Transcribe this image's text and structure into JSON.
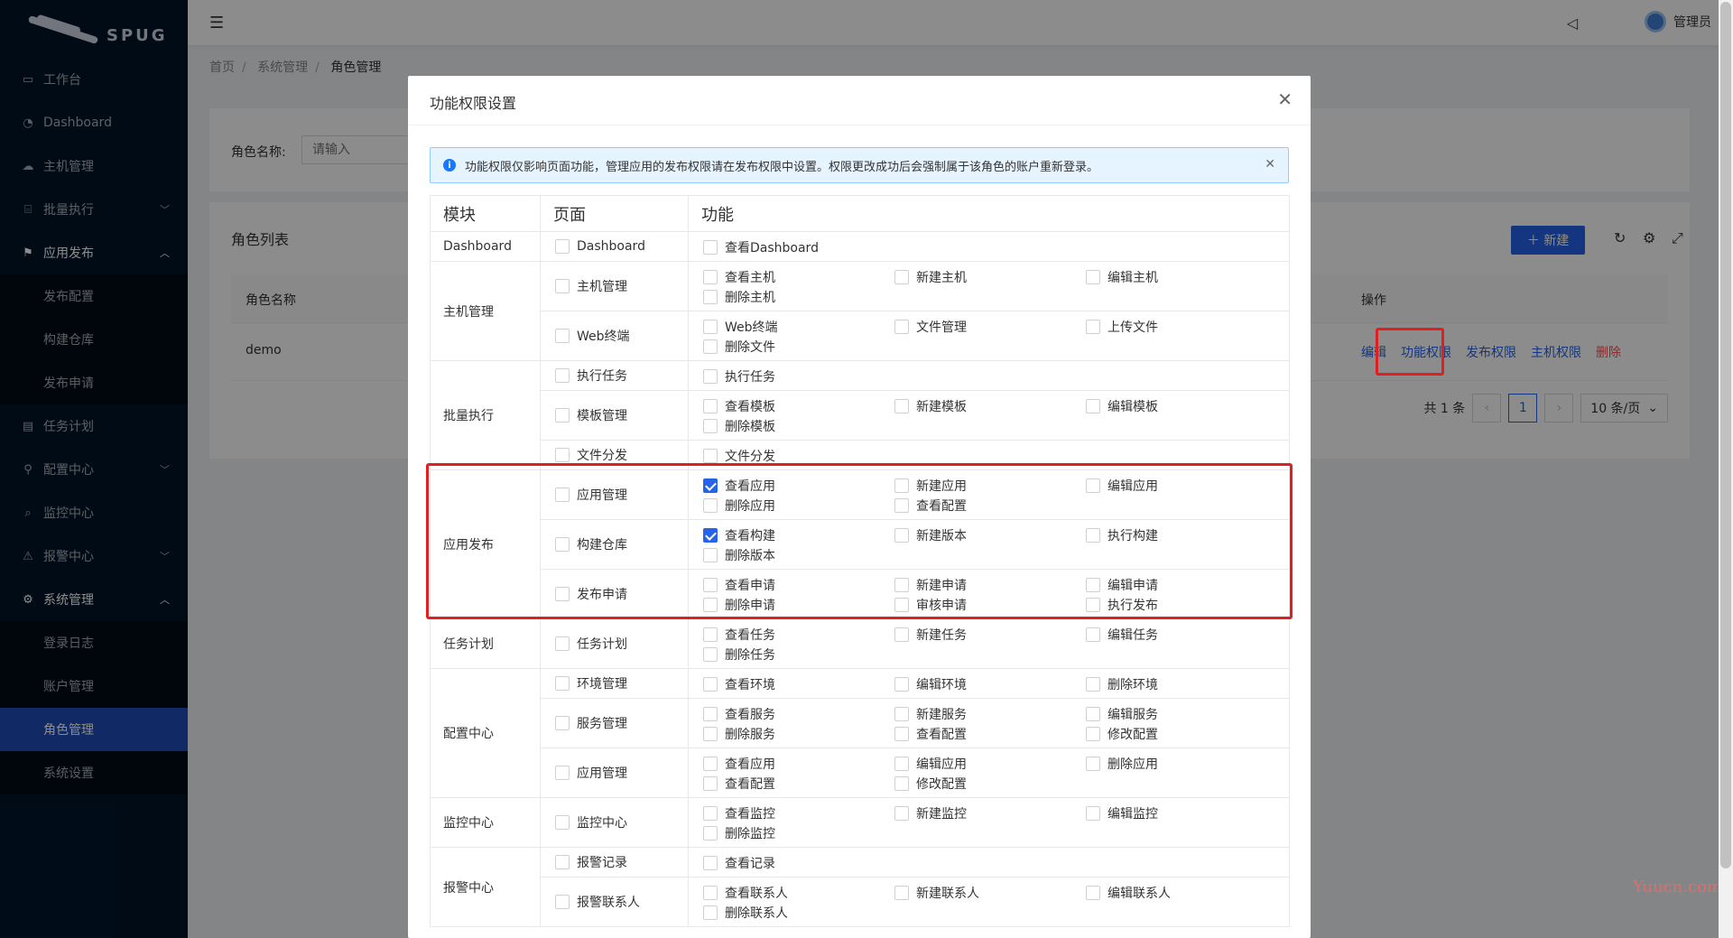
{
  "logo": {
    "text": "SPUG"
  },
  "sidebar": {
    "items": [
      {
        "label": "工作台",
        "icon": "desktop-icon"
      },
      {
        "label": "Dashboard",
        "icon": "dashboard-icon"
      },
      {
        "label": "主机管理",
        "icon": "cloud-server-icon"
      },
      {
        "label": "批量执行",
        "icon": "code-icon",
        "arrow": "down"
      },
      {
        "label": "应用发布",
        "icon": "flag-icon",
        "arrow": "up",
        "children": [
          "发布配置",
          "构建仓库",
          "发布申请"
        ]
      },
      {
        "label": "任务计划",
        "icon": "schedule-icon"
      },
      {
        "label": "配置中心",
        "icon": "deployment-icon",
        "arrow": "down"
      },
      {
        "label": "监控中心",
        "icon": "monitor-icon"
      },
      {
        "label": "报警中心",
        "icon": "alert-icon",
        "arrow": "down"
      },
      {
        "label": "系统管理",
        "icon": "setting-icon",
        "arrow": "up",
        "children": [
          "登录日志",
          "账户管理",
          "角色管理",
          "系统设置"
        ]
      }
    ],
    "active": "角色管理"
  },
  "header": {
    "user": "管理员"
  },
  "breadcrumb": [
    "首页",
    "系统管理",
    "角色管理"
  ],
  "search": {
    "label": "角色名称:",
    "placeholder": "请输入"
  },
  "list": {
    "title": "角色列表",
    "add_label": "新建",
    "columns": {
      "name": "角色名称",
      "ops": "操作"
    },
    "rows": [
      {
        "name": "demo"
      }
    ],
    "ops": [
      "编辑",
      "功能权限",
      "发布权限",
      "主机权限",
      "删除"
    ],
    "pager": {
      "total": "共 1 条",
      "current": "1",
      "size": "10 条/页"
    }
  },
  "modal": {
    "title": "功能权限设置",
    "alert": "功能权限仅影响页面功能，管理应用的发布权限请在发布权限中设置。权限更改成功后会强制属于该角色的账户重新登录。",
    "headers": [
      "模块",
      "页面",
      "功能"
    ],
    "modules": [
      {
        "name": "Dashboard",
        "pages": [
          {
            "name": "Dashboard",
            "funcs": [
              {
                "l": "查看Dashboard"
              }
            ]
          }
        ]
      },
      {
        "name": "主机管理",
        "pages": [
          {
            "name": "主机管理",
            "funcs": [
              {
                "l": "查看主机"
              },
              {
                "l": "新建主机"
              },
              {
                "l": "编辑主机"
              },
              {
                "l": "删除主机"
              }
            ]
          },
          {
            "name": "Web终端",
            "funcs": [
              {
                "l": "Web终端"
              },
              {
                "l": "文件管理"
              },
              {
                "l": "上传文件"
              },
              {
                "l": "删除文件"
              }
            ]
          }
        ]
      },
      {
        "name": "批量执行",
        "pages": [
          {
            "name": "执行任务",
            "funcs": [
              {
                "l": "执行任务"
              }
            ]
          },
          {
            "name": "模板管理",
            "funcs": [
              {
                "l": "查看模板"
              },
              {
                "l": "新建模板"
              },
              {
                "l": "编辑模板"
              },
              {
                "l": "删除模板"
              }
            ]
          },
          {
            "name": "文件分发",
            "funcs": [
              {
                "l": "文件分发"
              }
            ]
          }
        ]
      },
      {
        "name": "应用发布",
        "pages": [
          {
            "name": "应用管理",
            "funcs": [
              {
                "l": "查看应用",
                "c": true
              },
              {
                "l": "新建应用"
              },
              {
                "l": "编辑应用"
              },
              {
                "l": "删除应用"
              },
              {
                "l": "查看配置"
              }
            ]
          },
          {
            "name": "构建仓库",
            "funcs": [
              {
                "l": "查看构建",
                "c": true
              },
              {
                "l": "新建版本"
              },
              {
                "l": "执行构建"
              },
              {
                "l": "删除版本"
              }
            ]
          },
          {
            "name": "发布申请",
            "funcs": [
              {
                "l": "查看申请"
              },
              {
                "l": "新建申请"
              },
              {
                "l": "编辑申请"
              },
              {
                "l": "删除申请"
              },
              {
                "l": "审核申请"
              },
              {
                "l": "执行发布"
              }
            ]
          }
        ]
      },
      {
        "name": "任务计划",
        "pages": [
          {
            "name": "任务计划",
            "funcs": [
              {
                "l": "查看任务"
              },
              {
                "l": "新建任务"
              },
              {
                "l": "编辑任务"
              },
              {
                "l": "删除任务"
              }
            ]
          }
        ]
      },
      {
        "name": "配置中心",
        "pages": [
          {
            "name": "环境管理",
            "funcs": [
              {
                "l": "查看环境"
              },
              {
                "l": "编辑环境"
              },
              {
                "l": "删除环境"
              }
            ]
          },
          {
            "name": "服务管理",
            "funcs": [
              {
                "l": "查看服务"
              },
              {
                "l": "新建服务"
              },
              {
                "l": "编辑服务"
              },
              {
                "l": "删除服务"
              },
              {
                "l": "查看配置"
              },
              {
                "l": "修改配置"
              }
            ]
          },
          {
            "name": "应用管理",
            "funcs": [
              {
                "l": "查看应用"
              },
              {
                "l": "编辑应用"
              },
              {
                "l": "删除应用"
              },
              {
                "l": "查看配置"
              },
              {
                "l": "修改配置"
              }
            ]
          }
        ]
      },
      {
        "name": "监控中心",
        "pages": [
          {
            "name": "监控中心",
            "funcs": [
              {
                "l": "查看监控"
              },
              {
                "l": "新建监控"
              },
              {
                "l": "编辑监控"
              },
              {
                "l": "删除监控"
              }
            ]
          }
        ]
      },
      {
        "name": "报警中心",
        "pages": [
          {
            "name": "报警记录",
            "funcs": [
              {
                "l": "查看记录"
              }
            ]
          },
          {
            "name": "报警联系人",
            "funcs": [
              {
                "l": "查看联系人"
              },
              {
                "l": "新建联系人"
              },
              {
                "l": "编辑联系人"
              },
              {
                "l": "删除联系人"
              }
            ]
          }
        ]
      }
    ]
  },
  "watermark": "Yuucn.com",
  "colors": {
    "primary": "#2563eb",
    "sidebar": "#001529",
    "highlight": "#e02020",
    "danger": "#ff4d4f"
  }
}
